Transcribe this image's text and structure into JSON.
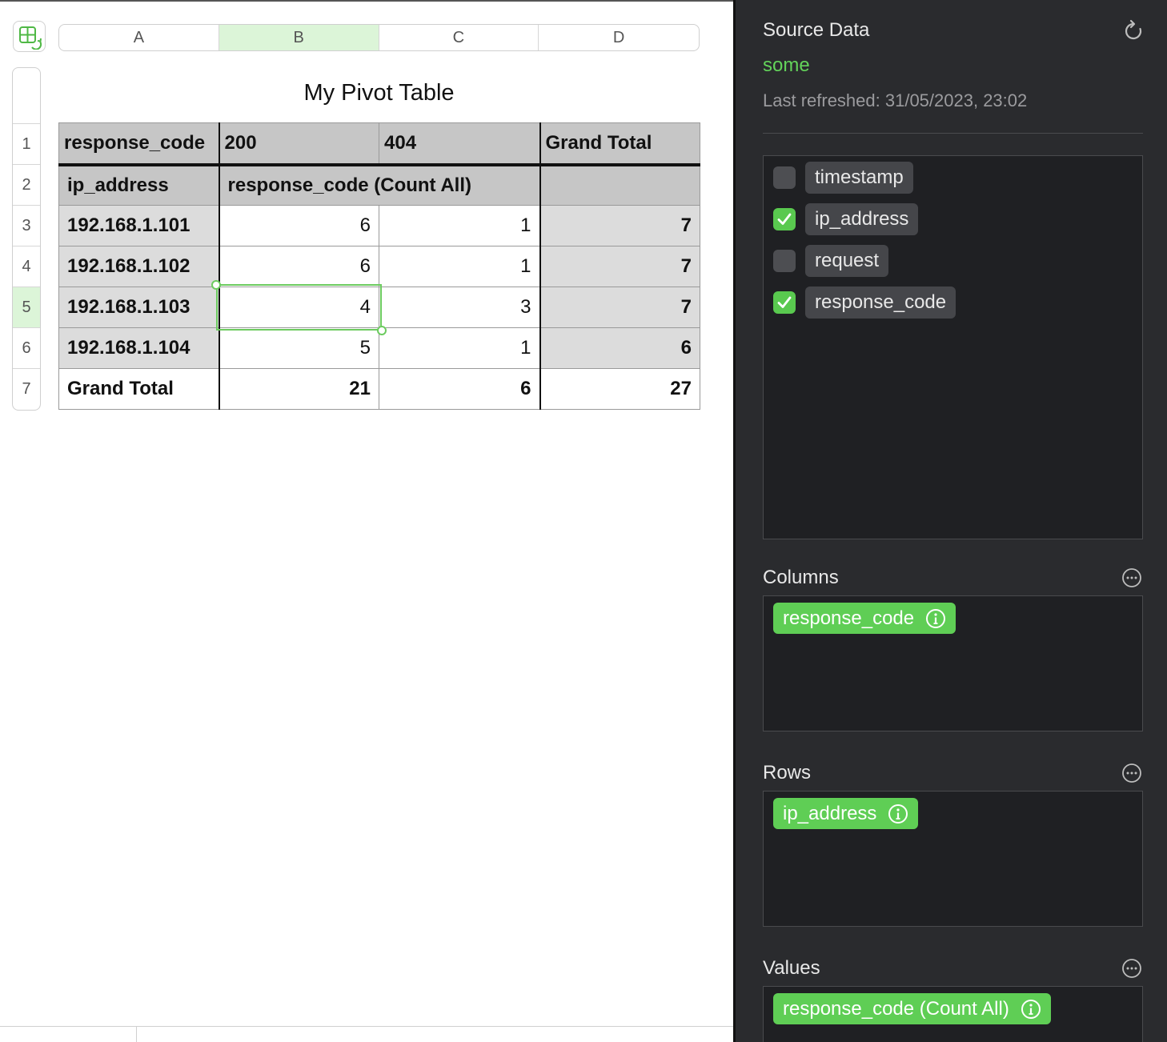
{
  "sheet": {
    "columns": [
      "A",
      "B",
      "C",
      "D"
    ],
    "selected_column": "B",
    "rows": [
      "1",
      "2",
      "3",
      "4",
      "5",
      "6",
      "7"
    ],
    "selected_row": "5",
    "title": "My Pivot Table"
  },
  "pivot": {
    "header_row": [
      "response_code",
      "200",
      "404",
      "Grand Total"
    ],
    "subheader_row": [
      "ip_address",
      "response_code (Count All)",
      ""
    ],
    "data_rows": [
      {
        "label": "192.168.1.101",
        "c200": "6",
        "c404": "1",
        "total": "7"
      },
      {
        "label": "192.168.1.102",
        "c200": "6",
        "c404": "1",
        "total": "7"
      },
      {
        "label": "192.168.1.103",
        "c200": "4",
        "c404": "3",
        "total": "7"
      },
      {
        "label": "192.168.1.104",
        "c200": "5",
        "c404": "1",
        "total": "6"
      }
    ],
    "total_row": {
      "label": "Grand Total",
      "c200": "21",
      "c404": "6",
      "total": "27"
    }
  },
  "sidebar": {
    "title": "Source Data",
    "source_name": "some",
    "last_refreshed": "Last refreshed: 31/05/2023, 23:02",
    "fields": [
      {
        "name": "timestamp",
        "checked": false
      },
      {
        "name": "ip_address",
        "checked": true
      },
      {
        "name": "request",
        "checked": false
      },
      {
        "name": "response_code",
        "checked": true
      }
    ],
    "columns_label": "Columns",
    "columns_field": "response_code",
    "rows_label": "Rows",
    "rows_field": "ip_address",
    "values_label": "Values",
    "values_field": "response_code (Count All)"
  },
  "colors": {
    "accent_green": "#5fce55",
    "sidebar_bg": "#2a2b2e",
    "selection": "#6ccb5f"
  },
  "icons": {
    "table_button": "table-refresh-icon",
    "refresh": "refresh-icon",
    "more": "ellipsis-circle-icon",
    "info": "info-icon",
    "check": "checkmark-icon"
  }
}
